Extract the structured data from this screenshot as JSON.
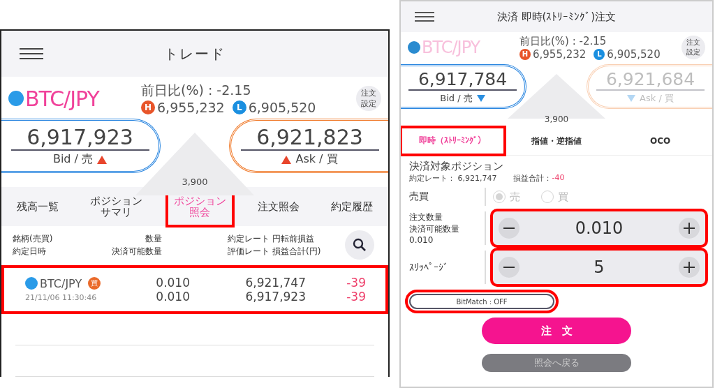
{
  "left_screen": {
    "title": "トレード",
    "quote": {
      "symbol": "BTC/JPY",
      "symbol_faded": false,
      "change": "前日比(%) : -2.15",
      "high": {
        "badge": "H",
        "value": "6,955,232"
      },
      "low": {
        "badge": "L",
        "value": "6,905,520"
      },
      "settings_button": [
        "注文",
        "設定"
      ],
      "bid": {
        "price": "6,917,923",
        "label": "Bid / 売",
        "rising": true,
        "disabled": false
      },
      "ask": {
        "price": "6,921,823",
        "label": "Ask / 買",
        "rising": true,
        "disabled": false
      },
      "spread": "3,900"
    },
    "tabs": [
      {
        "lines": [
          "残高一覧"
        ],
        "selected": false,
        "highlighted": false
      },
      {
        "lines": [
          "ポジション",
          "サマリ"
        ],
        "selected": false,
        "highlighted": false
      },
      {
        "lines": [
          "ポジション",
          "照会"
        ],
        "selected": true,
        "highlighted": true
      },
      {
        "lines": [
          "注文照会"
        ],
        "selected": false,
        "highlighted": false
      },
      {
        "lines": [
          "約定履歴"
        ],
        "selected": false,
        "highlighted": false
      }
    ],
    "columns": [
      [
        "銘柄(売買)",
        "約定日時"
      ],
      [
        "数量",
        "決済可能数量"
      ],
      [
        "約定レート",
        "評価レート"
      ],
      [
        "円転前損益",
        "損益合計(円)"
      ]
    ],
    "rows": [
      {
        "symbol": "BTC/JPY",
        "side": "買",
        "datetime": "21/11/06 11:30:46",
        "quantity": "0.010",
        "closable_quantity": "0.010",
        "rate": "6,921,747",
        "valuation_rate": "6,917,923",
        "pnl": "-39",
        "pnl_total": "-39",
        "highlighted": true
      }
    ]
  },
  "right_screen": {
    "title": "決済 即時(ｽﾄﾘｰﾐﾝｸﾞ)注文",
    "quote": {
      "symbol": "BTC/JPY",
      "symbol_faded": true,
      "change": "前日比(%) : -2.15",
      "high": {
        "badge": "H",
        "value": "6,955,232"
      },
      "low": {
        "badge": "L",
        "value": "6,905,520"
      },
      "settings_button": [
        "注文",
        "設定"
      ],
      "bid": {
        "price": "6,917,784",
        "label": "Bid / 売",
        "rising": false,
        "disabled": false
      },
      "ask": {
        "price": "6,921,684",
        "label": "Ask / 買",
        "rising": false,
        "disabled": true
      },
      "spread": "3,900"
    },
    "tabs": [
      {
        "label": "即時（ｽﾄﾘｰﾐﾝｸﾞ）",
        "selected": true,
        "highlighted": true
      },
      {
        "label": "指値・逆指値",
        "selected": false,
        "highlighted": false
      },
      {
        "label": "OCO",
        "selected": false,
        "highlighted": false
      }
    ],
    "position": {
      "title": "決済対象ポジション",
      "rate": "約定レート： 6,921,747",
      "pnl_label": "損益合計：",
      "pnl_value": "-40"
    },
    "side": {
      "label": "売買",
      "disabled": true,
      "options": [
        {
          "label": "売",
          "selected": true
        },
        {
          "label": "買",
          "selected": false
        }
      ]
    },
    "quantity": {
      "label": "注文数量",
      "value": "0.010",
      "note_label": "決済可能数量",
      "note_value": "0.010",
      "highlighted": true
    },
    "slippage": {
      "label": "ｽﾘｯﾍﾟｰｼﾞ",
      "value": "5",
      "highlighted": true
    },
    "bitmatch": {
      "label": "BitMatch : OFF",
      "highlighted": true
    },
    "order_button": "注　文",
    "back_button": "照会へ戻る"
  }
}
